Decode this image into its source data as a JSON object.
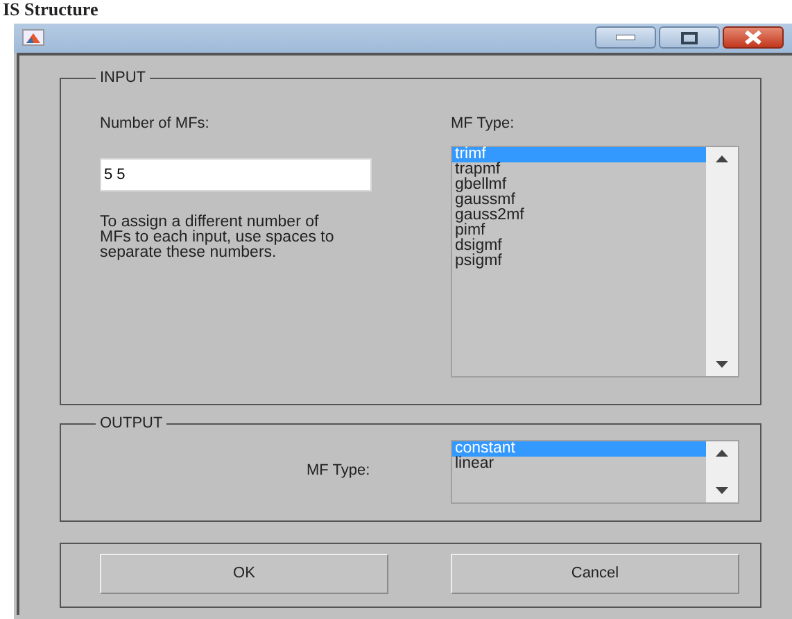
{
  "heading": "IS Structure",
  "input": {
    "title": "INPUT",
    "count_label": "Number of MFs:",
    "count_value": "5 5",
    "help": "To assign a different number of MFs to each input, use spaces to separate these numbers.",
    "type_label": "MF Type:",
    "types": [
      {
        "label": "trimf",
        "selected": true
      },
      {
        "label": "trapmf",
        "selected": false
      },
      {
        "label": "gbellmf",
        "selected": false
      },
      {
        "label": "gaussmf",
        "selected": false
      },
      {
        "label": "gauss2mf",
        "selected": false
      },
      {
        "label": "pimf",
        "selected": false
      },
      {
        "label": "dsigmf",
        "selected": false
      },
      {
        "label": "psigmf",
        "selected": false
      }
    ]
  },
  "output": {
    "title": "OUTPUT",
    "type_label": "MF Type:",
    "types": [
      {
        "label": "constant",
        "selected": true
      },
      {
        "label": "linear",
        "selected": false
      }
    ]
  },
  "buttons": [
    "OK",
    "Cancel"
  ]
}
